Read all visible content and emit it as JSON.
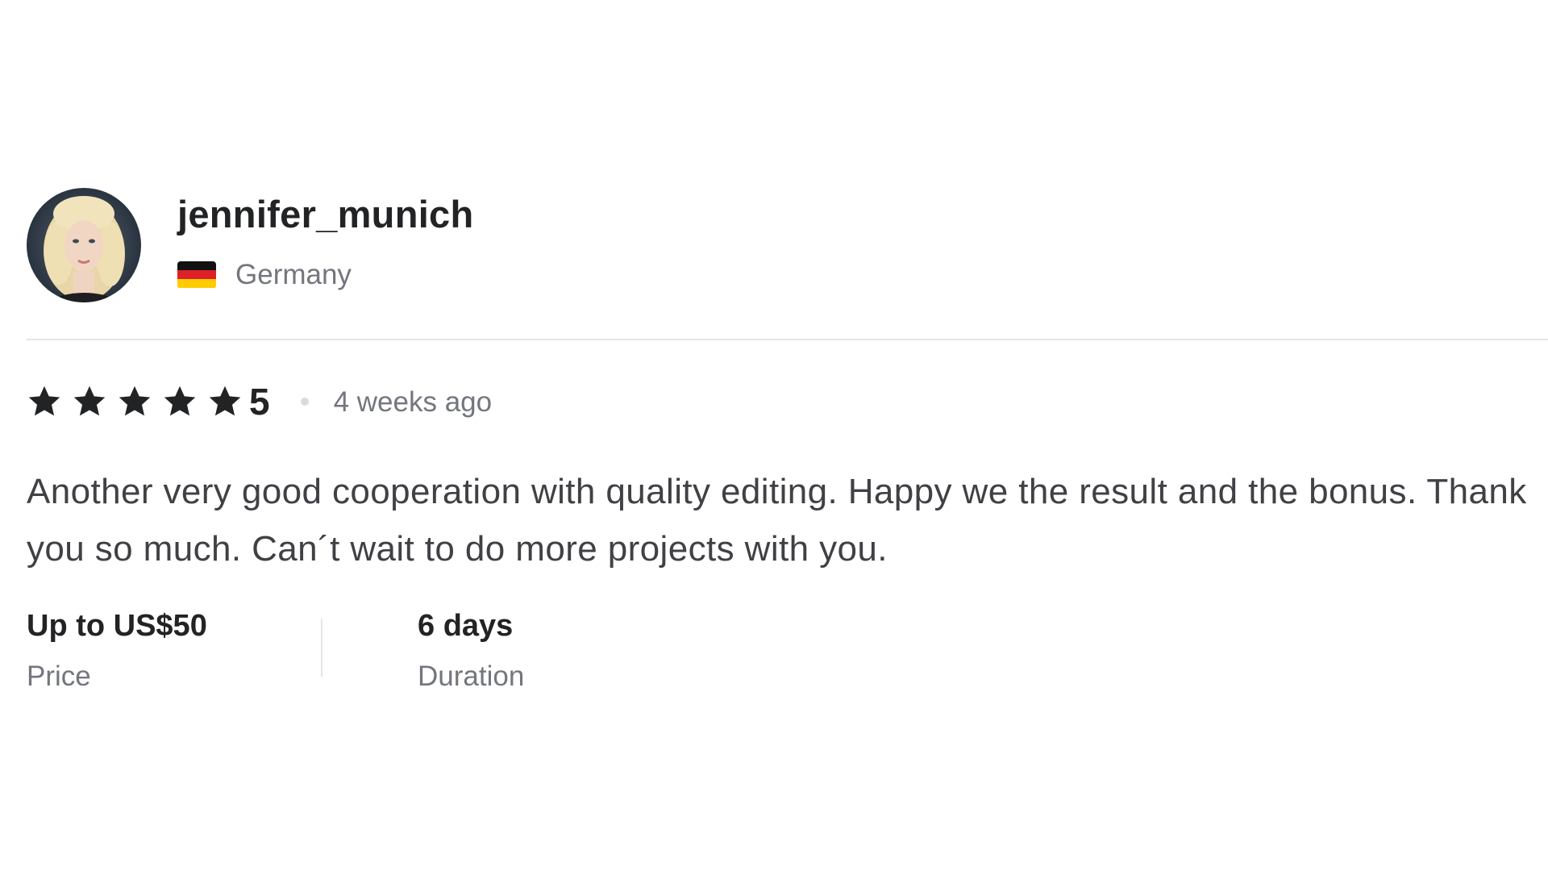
{
  "reviewer": {
    "username": "jennifer_munich",
    "country": "Germany",
    "flag_colors": [
      "#111111",
      "#dd1f26",
      "#ffcc00"
    ]
  },
  "review": {
    "rating_value": "5",
    "stars": 5,
    "time_ago": "4 weeks ago",
    "text": "Another very good cooperation with quality editing. Happy we the result and the bonus. Thank you so much. Can´t wait to do more projects with you."
  },
  "meta": {
    "price_value": "Up to US$50",
    "price_label": "Price",
    "duration_value": "6 days",
    "duration_label": "Duration"
  },
  "colors": {
    "text_primary": "#222325",
    "text_secondary": "#74767e",
    "divider": "#e4e5e7",
    "star": "#222325"
  }
}
